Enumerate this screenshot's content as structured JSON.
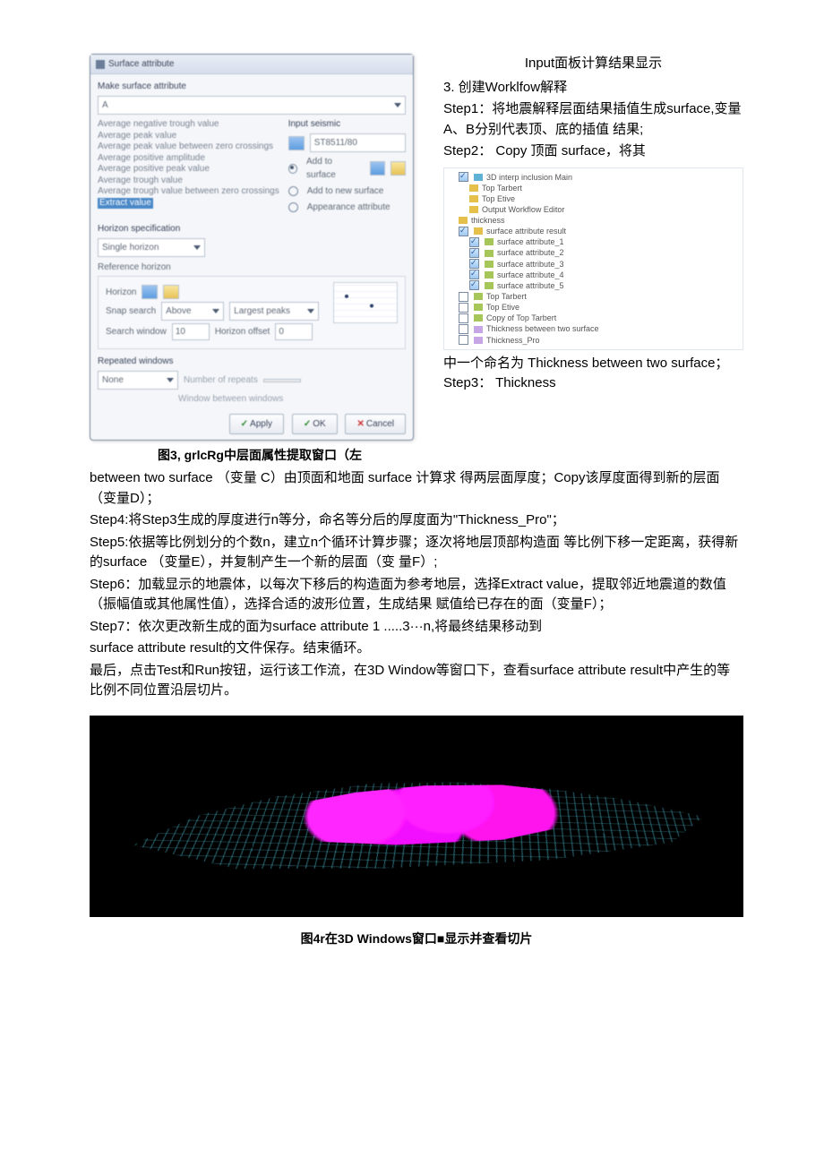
{
  "header_right": "Input面板计算结果显示",
  "dialog": {
    "title": "Surface attribute",
    "section_make": "Make surface attribute",
    "combo1": "A",
    "attr_list": [
      "Average negative trough value",
      "Average peak value",
      "Average peak value between zero crossings",
      "Average positive amplitude",
      "Average positive peak value",
      "Average trough value",
      "Average trough value between zero crossings"
    ],
    "attr_selected": "Extract value",
    "input_seismic_label": "Input seismic",
    "seismic_value": "ST8511/80",
    "radio_add_to_surface": "Add to surface",
    "radio_add_new": "Add to new surface",
    "radio_appearance": "Appearance attribute",
    "horizon_spec": "Horizon specification",
    "single_horizon": "Single horizon",
    "ref_horizon": "Reference horizon",
    "horizon_label": "Horizon",
    "snap_label": "Snap search",
    "snap_value": "Above",
    "largest_peaks": "Largest peaks",
    "search_window": "Search window",
    "search_val": "10",
    "horizon_offset": "Horizon offset",
    "offset_val": "0",
    "repeated": "Repeated windows",
    "none": "None",
    "num_repeats": "Number of repeats",
    "window_between": "Window between windows",
    "btn_apply": "Apply",
    "btn_ok": "OK",
    "btn_cancel": "Cancel"
  },
  "caption_fig3": "图3, grlcRg中层面属性提取窗口（左",
  "right_text": {
    "l1": "3. 创建Worklfow解释",
    "l2": "Step1：将地震解释层面结果插值生成surface,变量A、B分别代表顶、底的插值 结果;",
    "l3": "Step2： Copy 顶面 surface，将其"
  },
  "tree": {
    "n0": "3D interp inclusion Main",
    "n1": "Top Tarbert",
    "n2": "Top Etive",
    "n3": "Output Workflow Editor",
    "n4": "thickness",
    "n5": "surface attribute result",
    "n6_1": "surface attribute_1",
    "n6_2": "surface attribute_2",
    "n6_3": "surface attribute_3",
    "n6_4": "surface attribute_4",
    "n6_5": "surface attribute_5",
    "n7": "Top Tarbert",
    "n8": "Top Etive",
    "n9": "Copy of Top Tarbert",
    "n10": "Thickness between two surface",
    "n11": "Thickness_Pro"
  },
  "after_tree_1": "中一个命名为 Thickness  between two surface； Step3： Thickness",
  "para1": "between two surface （变量 C）由顶面和地面 surface 计算求 得两层面厚度；Copy该厚度面得到新的层面（变量D）；",
  "para2": "Step4:将Step3生成的厚度进行n等分，命名等分后的厚度面为\"Thickness_Pro\"；",
  "para3": "Step5:依据等比例划分的个数n，建立n个循环计算步骤；逐次将地层顶部构造面 等比例下移一定距离，获得新的surface （变量E），并复制产生一个新的层面（变 量F）;",
  "para4": "Step6：加载显示的地震体，以每次下移后的构造面为参考地层，选择Extract value，提取邻近地震道的数值（振幅值或其他属性值），选择合适的波形位置，生成结果 赋值给已存在的面（变量F）；",
  "para5": "Step7：依次更改新生成的面为surface attribute 1 .....3···n,将最终结果移动到",
  "para6": "surface attribute result的文件保存。结束循环。",
  "para7": "最后，点击Test和Run按钮，运行该工作流，在3D    Window等窗口下，查看surface attribute result中产生的等比例不同位置沿层切片。",
  "caption_fig4": "图4r在3D Windows窗口■显示并查看切片"
}
